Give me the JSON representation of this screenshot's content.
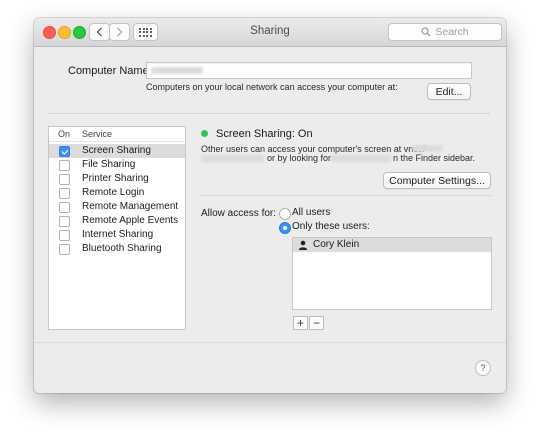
{
  "window": {
    "title": "Sharing",
    "search_placeholder": "Search"
  },
  "computer_name": {
    "label": "Computer Name:",
    "value": "",
    "note": "Computers on your local network can access your computer at:",
    "edit_button": "Edit..."
  },
  "services": {
    "header_on": "On",
    "header_service": "Service",
    "items": [
      {
        "label": "Screen Sharing",
        "checked": true,
        "selected": true
      },
      {
        "label": "File Sharing",
        "checked": false,
        "selected": false
      },
      {
        "label": "Printer Sharing",
        "checked": false,
        "selected": false
      },
      {
        "label": "Remote Login",
        "checked": false,
        "selected": false
      },
      {
        "label": "Remote Management",
        "checked": false,
        "selected": false
      },
      {
        "label": "Remote Apple Events",
        "checked": false,
        "selected": false
      },
      {
        "label": "Internet Sharing",
        "checked": false,
        "selected": false
      },
      {
        "label": "Bluetooth Sharing",
        "checked": false,
        "selected": false
      }
    ]
  },
  "detail": {
    "status": "Screen Sharing: On",
    "status_color": "#2fc455",
    "desc_prefix": "Other users can access your computer's screen at vnc://",
    "desc_middle": "or by looking for",
    "desc_suffix": "n the Finder sidebar.",
    "computer_settings_button": "Computer Settings...",
    "access_label": "Allow access for:",
    "option_all": "All users",
    "option_only": "Only these users:",
    "selected_option": "only",
    "users": [
      "Cory Klein"
    ],
    "add_button": "+",
    "remove_button": "−",
    "help_button": "?"
  }
}
